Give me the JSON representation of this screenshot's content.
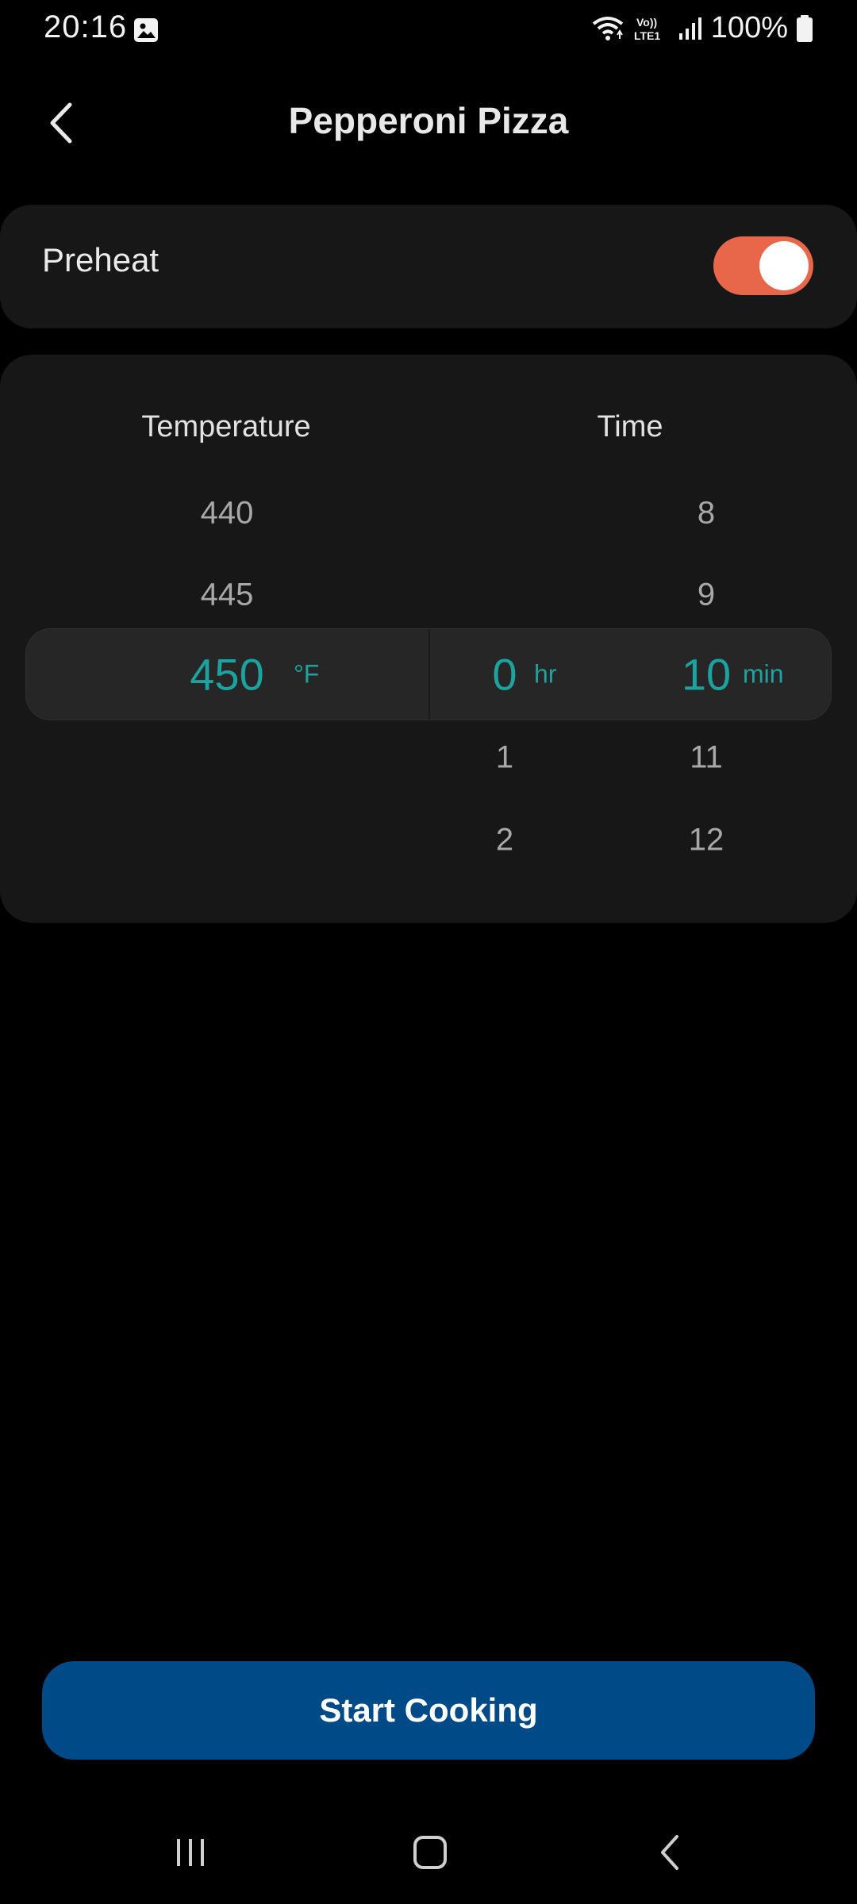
{
  "status_bar": {
    "time": "20:16",
    "battery": "100%",
    "network_label": "Vo)) LTE1",
    "icons": [
      "gallery-icon",
      "wifi-icon",
      "volte-icon",
      "signal-icon",
      "battery-icon"
    ]
  },
  "header": {
    "title": "Pepperoni Pizza",
    "back_icon": "chevron-left-icon"
  },
  "preheat": {
    "label": "Preheat",
    "enabled": true
  },
  "picker": {
    "temperature_header": "Temperature",
    "time_header": "Time",
    "temperature": {
      "above": [
        "440",
        "445"
      ],
      "selected": "450",
      "unit": "°F",
      "below": []
    },
    "hours": {
      "above": [],
      "selected": "0",
      "unit": "hr",
      "below": [
        "1",
        "2"
      ]
    },
    "minutes": {
      "above": [
        "8",
        "9"
      ],
      "selected": "10",
      "unit": "min",
      "below": [
        "11",
        "12"
      ]
    }
  },
  "start_button": {
    "label": "Start Cooking"
  },
  "nav_bar": {
    "items": [
      "recents-icon",
      "home-icon",
      "back-icon"
    ]
  },
  "colors": {
    "accent_teal": "#1ca3a0",
    "toggle_orange": "#e8664a",
    "button_blue": "#004a87"
  }
}
